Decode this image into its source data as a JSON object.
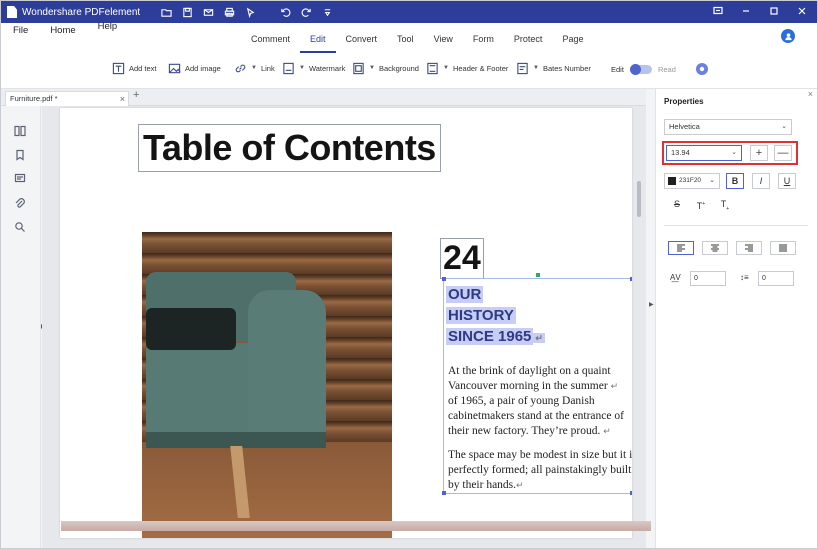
{
  "app": {
    "name": "Wondershare PDFelement"
  },
  "menu": {
    "items": [
      "File",
      "Home",
      "Help"
    ]
  },
  "tabs": [
    "Comment",
    "Edit",
    "Convert",
    "Tool",
    "View",
    "Form",
    "Protect",
    "Page"
  ],
  "active_tab": "Edit",
  "toolbar": {
    "add_text": "Add text",
    "add_image": "Add image",
    "link": "Link",
    "watermark": "Watermark",
    "background": "Background",
    "header_footer": "Header & Footer",
    "bates_number": "Bates Number",
    "edit_label": "Edit",
    "read_label": "Read"
  },
  "document_tab": {
    "name": "Furniture.pdf *",
    "close": "×",
    "add": "+"
  },
  "document": {
    "title": "Table of Contents",
    "number": "24",
    "heading_lines": [
      "OUR",
      "HISTORY",
      "SINCE 1965"
    ],
    "para1_lines": [
      "At the brink of daylight on a quaint",
      "Vancouver morning in the summer",
      "of 1965, a pair of young Danish",
      "cabinetmakers stand at the entrance of",
      "their new factory. They’re proud."
    ],
    "para2_lines": [
      "The space may be modest in size but it is",
      "perfectly formed; all painstakingly built",
      "by their hands."
    ]
  },
  "properties": {
    "title": "Properties",
    "font": "Helvetica",
    "size": "13.94",
    "color_hex": "231F20",
    "bold": "B",
    "italic": "I",
    "underline": "U",
    "strike": "S",
    "superscript": "T",
    "subscript": "T",
    "char_spacing": "0",
    "line_spacing": "0",
    "plus": "+",
    "minus": "—"
  },
  "colors": {
    "title_bar": "#2d3e9a",
    "accent": "#4f63cf",
    "highlight": "#e03030"
  }
}
